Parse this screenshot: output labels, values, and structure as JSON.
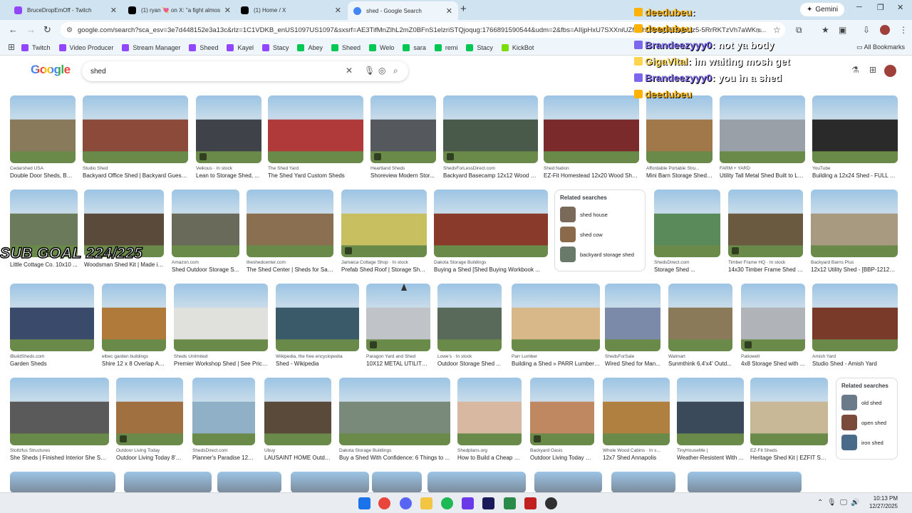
{
  "tabs": [
    {
      "label": "BruceDropEmOff - Twitch",
      "color": "#9146ff"
    },
    {
      "label": "(1) ryan 💘 on X: \"a fight almos",
      "color": "#000000"
    },
    {
      "label": "(1) Home / X",
      "color": "#000000"
    },
    {
      "label": "shed - Google Search",
      "color": "#4285f4"
    }
  ],
  "gemini_label": "Gemini",
  "url": "google.com/search?sca_esv=3e7d448152e3a13c&rlz=1C1VDKB_enUS1097US1097&sxsrf=AE3TifMnZlhL2mZ0BFnS1elzriSTQjoqug:1766891590544&udm=2&fbs=AIIjpHxU7SXXniUZfeShr2fp4giZjSkgYzz5-5RrRKTzVh7aWKn…",
  "bookmarks": [
    {
      "label": "Twitch",
      "color": "#9146ff"
    },
    {
      "label": "Video Producer",
      "color": "#9146ff"
    },
    {
      "label": "Stream Manager",
      "color": "#9146ff"
    },
    {
      "label": "Sheed",
      "color": "#9146ff"
    },
    {
      "label": "Kayel",
      "color": "#9146ff"
    },
    {
      "label": "Stacy",
      "color": "#9146ff"
    },
    {
      "label": "Abey",
      "color": "#00c853"
    },
    {
      "label": "Sheed",
      "color": "#00c853"
    },
    {
      "label": "Welo",
      "color": "#00c853"
    },
    {
      "label": "sara",
      "color": "#00c853"
    },
    {
      "label": "remi",
      "color": "#00c853"
    },
    {
      "label": "Stacy",
      "color": "#00c853"
    },
    {
      "label": "KickBot",
      "color": "#7bdc00"
    }
  ],
  "all_bookmarks": "All Bookmarks",
  "google_logo": "Google",
  "search_query": "shed",
  "chat": [
    {
      "user": "deedubeu",
      "msg": ":",
      "user_color": "#ffb300"
    },
    {
      "user": "deedubeu",
      "msg": "",
      "user_color": "#ffb300"
    },
    {
      "user": "Brandeezyyy0",
      "msg": ": not ya body",
      "user_color": "#7b68ee"
    },
    {
      "user": "GigaVital",
      "msg": ": im waiting mosh get",
      "user_color": "#ffd54f"
    },
    {
      "user": "Brandeezyyy0",
      "msg": ": you in a shed",
      "user_color": "#7b68ee"
    },
    {
      "user": "deedubeu",
      "msg": "",
      "user_color": "#ffb300"
    }
  ],
  "sub_goal": "SUB GOAL 224/225",
  "row1": [
    {
      "src": "Cedarshed USA",
      "title": "Double Door Sheds, Bac...",
      "color": "#8a7a5c"
    },
    {
      "src": "Studio Shed",
      "title": "Backyard Office Shed | Backyard Guest ...",
      "color": "#8b4a3a"
    },
    {
      "src": "Veikous · In stock",
      "title": "Lean to Storage Shed, ...",
      "color": "#3f4248"
    },
    {
      "src": "The Shed Yard",
      "title": "The Shed Yard Custom Sheds",
      "color": "#b03a3a"
    },
    {
      "src": "Heartland Sheds",
      "title": "Shoreview Modern Stor...",
      "color": "#55595e"
    },
    {
      "src": "ShedsForLessDirect.com",
      "title": "Backyard Basecamp 12x12 Wood S...",
      "color": "#4a5a4a"
    },
    {
      "src": "Shed Nation",
      "title": "EZ-Fit Homestead 12x20 Wood She...",
      "color": "#7a2a2a"
    },
    {
      "src": "Affordable Portable Stru...",
      "title": "Mini Barn Storage Shed ...",
      "color": "#a0784a"
    },
    {
      "src": "FARM + YARD",
      "title": "Utility Tall Metal Shed Built to La...",
      "color": "#9aa0a8"
    },
    {
      "src": "YouTube",
      "title": "Building a 12x24 Shed - FULL B...",
      "color": "#2a2a2a"
    }
  ],
  "row2": [
    {
      "src": "",
      "title": "Little Cottage Co. 10x10 ...",
      "color": "#6a7a5a"
    },
    {
      "src": "",
      "title": "Woodsman Shed Kit | Made in...",
      "color": "#5a4a3a"
    },
    {
      "src": "Amazon.com",
      "title": "Shed Outdoor Storage S...",
      "color": "#6a6a5a"
    },
    {
      "src": "theshedcenter.com",
      "title": "The Shed Center | Sheds for Sale...",
      "color": "#8a7050"
    },
    {
      "src": "Jamaica Cottage Shop · In stock",
      "title": "Prefab Shed Roof | Storage She...",
      "color": "#c8c060"
    },
    {
      "src": "Dakota Storage Buildings",
      "title": "Buying a Shed [Shed Buying Workbook ...",
      "color": "#8a3a2a"
    },
    {
      "src": "ShedsDirect.com",
      "title": "Storage Shed ...",
      "color": "#5a8a5a"
    },
    {
      "src": "Timber Frame HQ · In stock",
      "title": "14x30 Timber Frame Shed -...",
      "color": "#6a5a40"
    },
    {
      "src": "Backyard Barns Plus",
      "title": "12x12 Utility Shed - [BBP-1212E-...",
      "color": "#a89a80"
    }
  ],
  "related1": {
    "heading": "Related searches",
    "items": [
      {
        "label": "shed house",
        "color": "#7a6a5a"
      },
      {
        "label": "shed cow",
        "color": "#8a6a4a"
      },
      {
        "label": "backyard storage shed",
        "color": "#6a7a6a"
      }
    ]
  },
  "row3": [
    {
      "src": "iBuildSheds.com",
      "title": "Garden Sheds",
      "color": "#3a4a6a"
    },
    {
      "src": "elbec garden buildings",
      "title": "Shire 12 x 8 Overlap Ap...",
      "color": "#b07a3a"
    },
    {
      "src": "Sheds Unlimited",
      "title": "Premier Workshop Shed | See Price...",
      "color": "#e0e0dc"
    },
    {
      "src": "Wikipedia, the free encyclopedia",
      "title": "Shed - Wikipedia",
      "color": "#3a5a6a"
    },
    {
      "src": "Paragon Yard and Shed",
      "title": "10X12 METAL UTILITY ...",
      "color": "#c0c4c8"
    },
    {
      "src": "Lowe's · In stock",
      "title": "Outdoor Storage Shed ...",
      "color": "#5a6a5a"
    },
    {
      "src": "Parr Lumber",
      "title": "Building a Shed » PARR Lumber ...",
      "color": "#d8b888"
    },
    {
      "src": "ShedsForSale",
      "title": "Wired Shed for Man...",
      "color": "#7a8aa8"
    },
    {
      "src": "Walmart",
      "title": "Sunmthink 6.4'x4' Outd...",
      "color": "#8a7a5a"
    },
    {
      "src": "Patiowell",
      "title": "4x8 Storage Shed with ...",
      "color": "#b0b4b8"
    },
    {
      "src": "Amish Yard",
      "title": "Studio Shed - Amish Yard",
      "color": "#7a3a2a"
    }
  ],
  "row4": [
    {
      "src": "Stoltzfus Structures",
      "title": "She Sheds | Finished Interior She She...",
      "color": "#5a5a5a"
    },
    {
      "src": "Outdoor Living Today",
      "title": "Outdoor Living Today 8'x...",
      "color": "#a07040"
    },
    {
      "src": "ShedsDirect.com",
      "title": "Planner's Paradise 12x2...",
      "color": "#90b0c8"
    },
    {
      "src": "Ubuy",
      "title": "LAUSAINT HOME Outdo...",
      "color": "#5a4a3a"
    },
    {
      "src": "Dakota Storage Buildings",
      "title": "Buy a Shed With Confidence: 6 Things to ...",
      "color": "#7a8a7a"
    },
    {
      "src": "Shedplans.org",
      "title": "How to Build a Cheap S...",
      "color": "#d8b8a0"
    },
    {
      "src": "Backyard Oasis",
      "title": "Outdoor Living Today 12...",
      "color": "#c08860"
    },
    {
      "src": "Whole Wood Cabins · In s...",
      "title": "12x7 Shed Annapolis",
      "color": "#b08040"
    },
    {
      "src": "TinyHouseMe |",
      "title": "Weather-Resistent With ...",
      "color": "#3a4a5a"
    },
    {
      "src": "EZ-Fit Sheds",
      "title": "Heritage Shed Kit | EZFIT She...",
      "color": "#c8b898"
    }
  ],
  "related2": {
    "heading": "Related searches",
    "items": [
      {
        "label": "old shed",
        "color": "#6a7a8a"
      },
      {
        "label": "open shed",
        "color": "#7a4a3a"
      },
      {
        "label": "iron shed",
        "color": "#4a6a8a"
      }
    ]
  },
  "clock": {
    "time": "10:13 PM",
    "date": "12/27/2025"
  }
}
